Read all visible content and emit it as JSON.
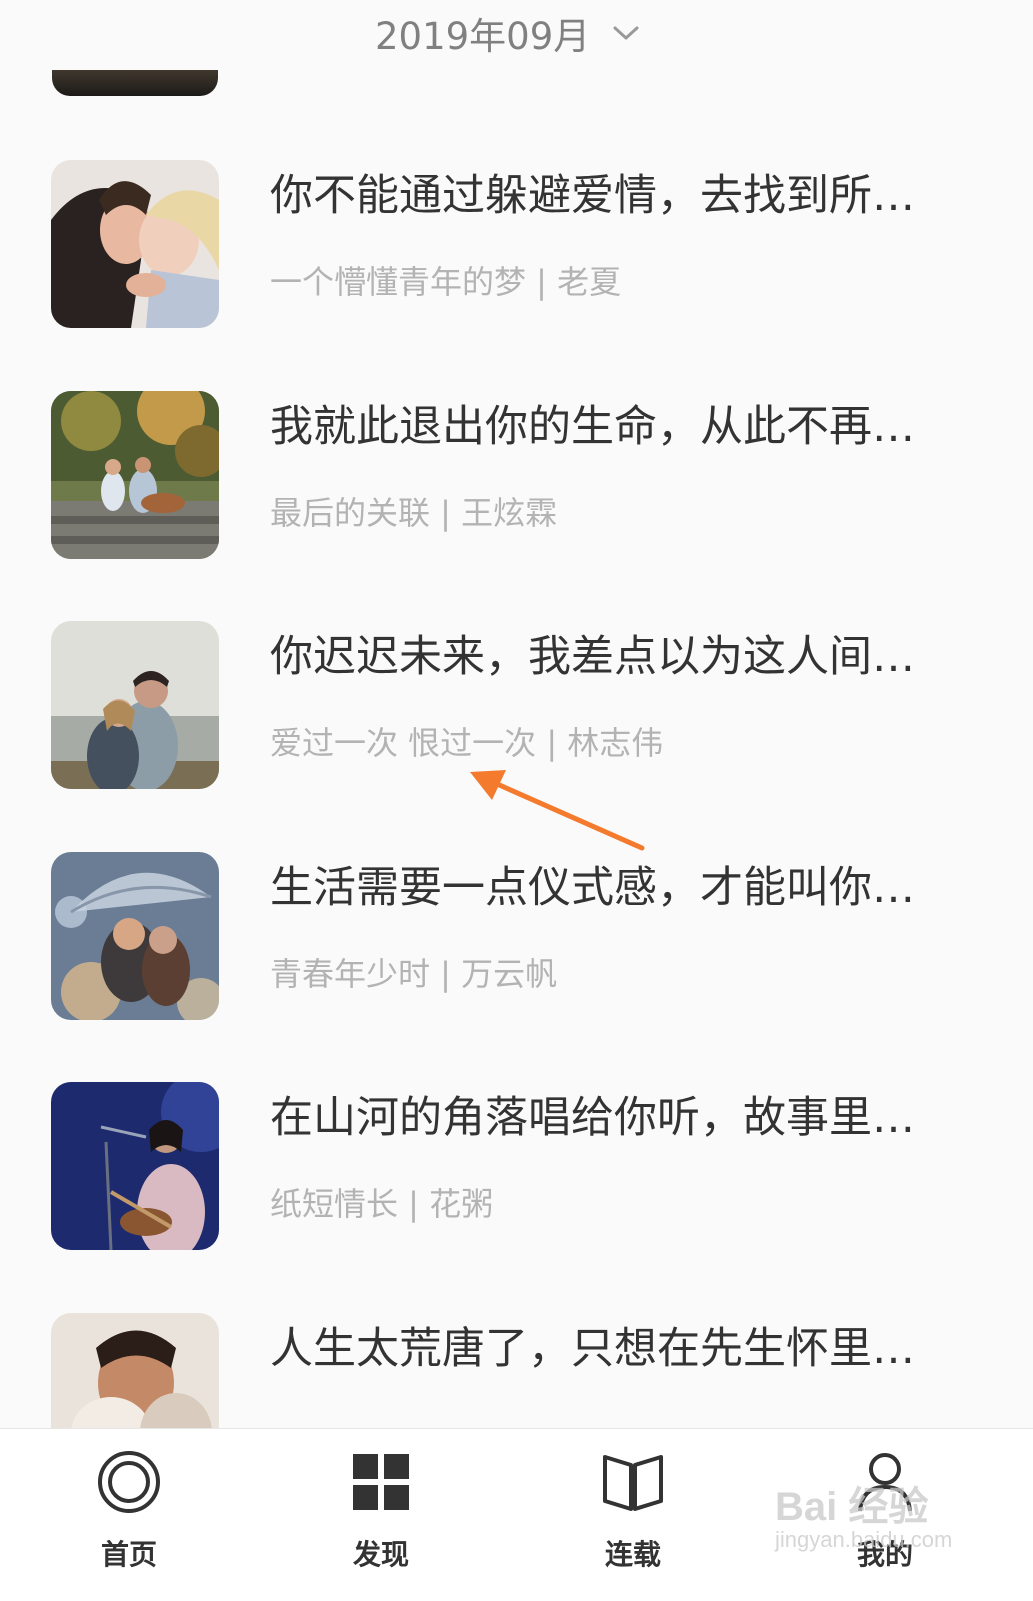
{
  "header": {
    "month_label": "2019年09月",
    "dropdown_icon": "chevron-down-icon"
  },
  "articles": [
    {
      "title": "你不能通过躲避爱情，去找到所…",
      "meta": "一个懵懂青年的梦 | 老夏"
    },
    {
      "title": "我就此退出你的生命，从此不再…",
      "meta": "最后的关联 | 王炫霖"
    },
    {
      "title": "你迟迟未来，我差点以为这人间…",
      "meta": "爱过一次 恨过一次 | 林志伟"
    },
    {
      "title": "生活需要一点仪式感，才能叫你…",
      "meta": "青春年少时 | 万云帆"
    },
    {
      "title": "在山河的角落唱给你听，故事里…",
      "meta": "纸短情长 | 花粥"
    },
    {
      "title": "人生太荒唐了，只想在先生怀里…",
      "meta": ""
    }
  ],
  "tabs": [
    {
      "label": "首页",
      "icon": "home-ring-icon"
    },
    {
      "label": "发现",
      "icon": "grid-icon"
    },
    {
      "label": "连载",
      "icon": "book-icon"
    },
    {
      "label": "我的",
      "icon": "user-icon"
    }
  ],
  "watermark": {
    "main": "Bai 经验",
    "sub": "jingyan.baidu.com"
  },
  "colors": {
    "accent_arrow": "#f47a2e",
    "title_text": "#333333",
    "meta_text": "#b3b3b3",
    "background": "#fafafa"
  }
}
